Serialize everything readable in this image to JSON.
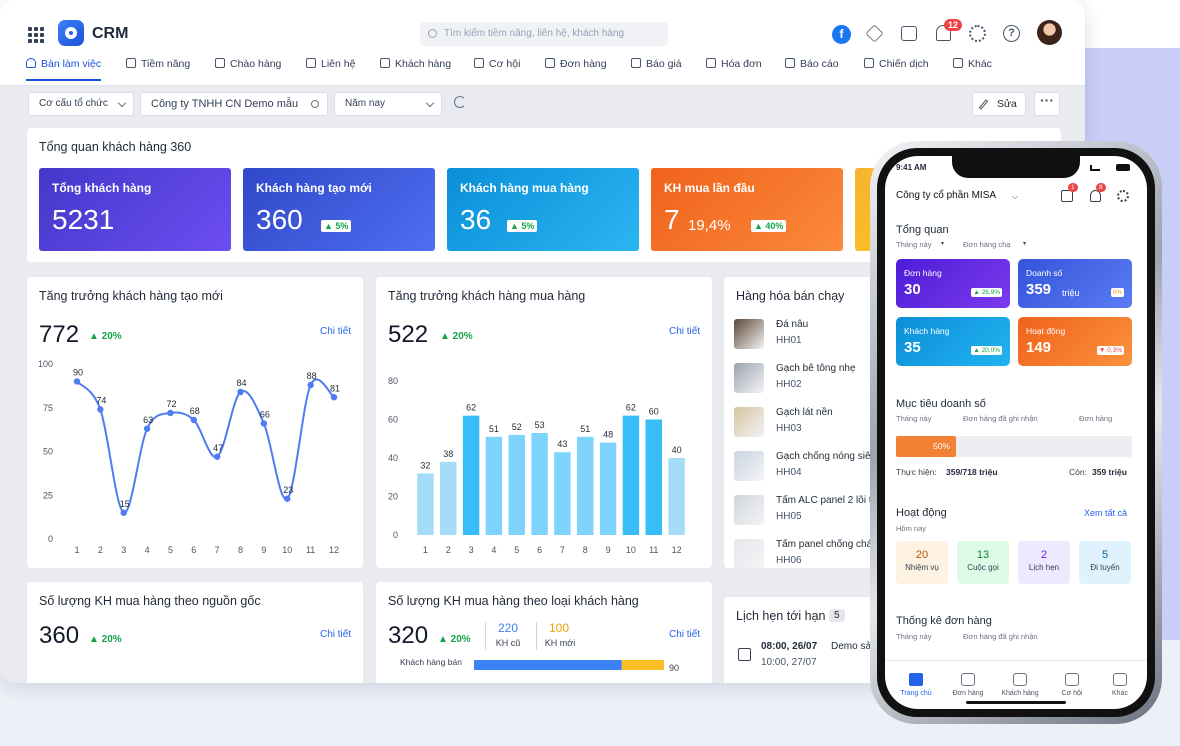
{
  "app": {
    "name": "CRM",
    "search_placeholder": "Tìm kiếm tiềm năng, liên hệ, khách hàng",
    "notification_count": "12"
  },
  "icons": [
    "apps-grid-icon",
    "facebook-icon",
    "package-icon",
    "calendar-icon",
    "bell-icon",
    "gear-icon",
    "help-icon",
    "search-icon",
    "refresh-icon",
    "pencil-icon"
  ],
  "nav": [
    {
      "label": "Bàn làm việc",
      "active": true
    },
    {
      "label": "Tiềm năng"
    },
    {
      "label": "Chào hàng"
    },
    {
      "label": "Liên hệ"
    },
    {
      "label": "Khách hàng"
    },
    {
      "label": "Cơ hội"
    },
    {
      "label": "Đơn hàng"
    },
    {
      "label": "Báo giá"
    },
    {
      "label": "Hóa đơn"
    },
    {
      "label": "Báo cáo"
    },
    {
      "label": "Chiến dịch"
    },
    {
      "label": "Khác"
    }
  ],
  "filters": {
    "org_structure": "Cơ cấu tổ chức",
    "company": "Công ty TNHH CN Demo mẫu",
    "period": "Năm nay",
    "edit": "Sửa",
    "more": "···"
  },
  "overview": {
    "title": "Tổng quan khách hàng 360",
    "kpis": [
      {
        "label": "Tổng khách hàng",
        "value": "5231",
        "color": "#4f46e5"
      },
      {
        "label": "Khách hàng tạo mới",
        "value": "360",
        "pct": "▲ 5%",
        "color": "#3b5bdb"
      },
      {
        "label": "Khách hàng mua hàng",
        "value": "36",
        "pct": "▲ 5%",
        "color": "#0ea5e9"
      },
      {
        "label": "KH mua lần đầu",
        "value": "7",
        "sub": "19,4%",
        "pct": "▲ 40%",
        "color": "#f97316"
      }
    ]
  },
  "growth_new": {
    "title": "Tăng trưởng khách hàng tạo mới",
    "value": "772",
    "change": "▲ 20%",
    "link": "Chi tiết",
    "chart_data": {
      "type": "line",
      "x": [
        1,
        2,
        3,
        4,
        5,
        6,
        7,
        8,
        9,
        10,
        11,
        12
      ],
      "values": [
        90,
        74,
        15,
        63,
        72,
        68,
        47,
        84,
        66,
        23,
        88,
        81
      ],
      "ylim": [
        0,
        100
      ],
      "yticks": [
        0,
        25,
        50,
        75,
        100
      ],
      "color": "#4f7cf0"
    }
  },
  "growth_buy": {
    "title": "Tăng trưởng khách hàng mua hàng",
    "value": "522",
    "change": "▲ 20%",
    "link": "Chi tiết",
    "chart_data": {
      "type": "bar",
      "categories": [
        1,
        2,
        3,
        4,
        5,
        6,
        7,
        8,
        9,
        10,
        11,
        12
      ],
      "values": [
        32,
        38,
        62,
        51,
        52,
        53,
        43,
        51,
        48,
        62,
        60,
        40
      ],
      "ylim": [
        0,
        80
      ],
      "yticks": [
        0,
        20,
        40,
        60,
        80
      ],
      "colors": [
        "#a5dcf7",
        "#a5dcf7",
        "#38bdf8",
        "#7dd3fc",
        "#7dd3fc",
        "#7dd3fc",
        "#7dd3fc",
        "#7dd3fc",
        "#7dd3fc",
        "#38bdf8",
        "#38bdf8",
        "#a5dcf7"
      ]
    }
  },
  "top_products": {
    "title": "Hàng hóa bán chạy",
    "items": [
      {
        "name": "Đá nâu",
        "code": "HH01",
        "color": "#5b4636"
      },
      {
        "name": "Gạch bê tông nhẹ",
        "code": "HH02",
        "color": "#9ca3af"
      },
      {
        "name": "Gạch lát nền",
        "code": "HH03",
        "color": "#d6c3a0"
      },
      {
        "name": "Gạch chống nóng siêu",
        "code": "HH04",
        "color": "#cbd5e1"
      },
      {
        "name": "Tấm ALC panel 2 lõi t",
        "code": "HH05",
        "color": "#d1d5db"
      },
      {
        "name": "Tấm panel chống cháy",
        "code": "HH06",
        "color": "#e5e7eb"
      }
    ]
  },
  "by_source": {
    "title": "Số lượng KH mua hàng theo nguồn gốc",
    "value": "360",
    "change": "▲ 20%",
    "link": "Chi tiết"
  },
  "by_type": {
    "title": "Số lượng KH mua hàng theo loại khách hàng",
    "value": "320",
    "change": "▲ 20%",
    "link": "Chi tiết",
    "old_value": "220",
    "old_label": "KH cũ",
    "new_value": "100",
    "new_label": "KH mới",
    "bar_label": "Khách hàng bán",
    "bar_end": "90",
    "chart_data": {
      "type": "bar",
      "categories": [
        "Khách hàng bán"
      ],
      "series": [
        {
          "name": "KH cũ",
          "values": [
            70
          ]
        },
        {
          "name": "KH mới",
          "values": [
            20
          ]
        }
      ],
      "colors": [
        "#3b82f6",
        "#fbbf24"
      ]
    }
  },
  "appointments": {
    "title": "Lịch hẹn tới hạn",
    "count": "5",
    "time1": "08:00, 26/07",
    "time2": "10:00, 27/07",
    "subject": "Demo sả"
  },
  "mobile": {
    "time": "9:41 AM",
    "company": "Công ty cổ phần MISA",
    "badges": [
      "1",
      "8"
    ],
    "overview": {
      "title": "Tổng quan",
      "filter1": "Tháng này",
      "filter2": "Đơn hàng chạ"
    },
    "tiles": [
      {
        "label": "Đơn hàng",
        "value": "30",
        "badge": "▲ 26,9%",
        "color": "#5b21d6"
      },
      {
        "label": "Doanh số",
        "value": "359",
        "unit": "triệu",
        "badge": "0%",
        "color": "#4063e8"
      },
      {
        "label": "Khách hàng",
        "value": "35",
        "badge": "▲ 20,0%",
        "color": "#0ea5e9"
      },
      {
        "label": "Hoạt động",
        "value": "149",
        "badge": "▼ 0,3%",
        "color": "#f97316"
      }
    ],
    "target": {
      "title": "Mục tiêu doanh số",
      "f1": "Tháng này",
      "f2": "Đơn hàng đã ghi nhận",
      "f3": "Đơn hàng",
      "progress": 50,
      "progress_label": "50%",
      "done_label": "Thực hiện:",
      "done_value": "359/718 triệu",
      "remain_label": "Còn:",
      "remain_value": "359 triệu"
    },
    "activity": {
      "title": "Hoạt động",
      "filter": "Hôm nay",
      "see_all": "Xem tất cả",
      "items": [
        {
          "value": "20",
          "label": "Nhiệm vụ",
          "bg": "#fef3e2",
          "fg": "#b45309"
        },
        {
          "value": "13",
          "label": "Cuộc gọi",
          "bg": "#dcfce7",
          "fg": "#15803d"
        },
        {
          "value": "2",
          "label": "Lịch hẹn",
          "bg": "#ede9fe",
          "fg": "#6d28d9"
        },
        {
          "value": "5",
          "label": "Đi tuyến",
          "bg": "#e0f2fe",
          "fg": "#0369a1"
        }
      ]
    },
    "orders": {
      "title": "Thống kê đơn hàng",
      "f1": "Tháng này",
      "f2": "Đơn hàng đã ghi nhận"
    },
    "tabs": [
      "Trang chủ",
      "Đơn hàng",
      "Khách hàng",
      "Cơ hội",
      "Khác"
    ]
  }
}
